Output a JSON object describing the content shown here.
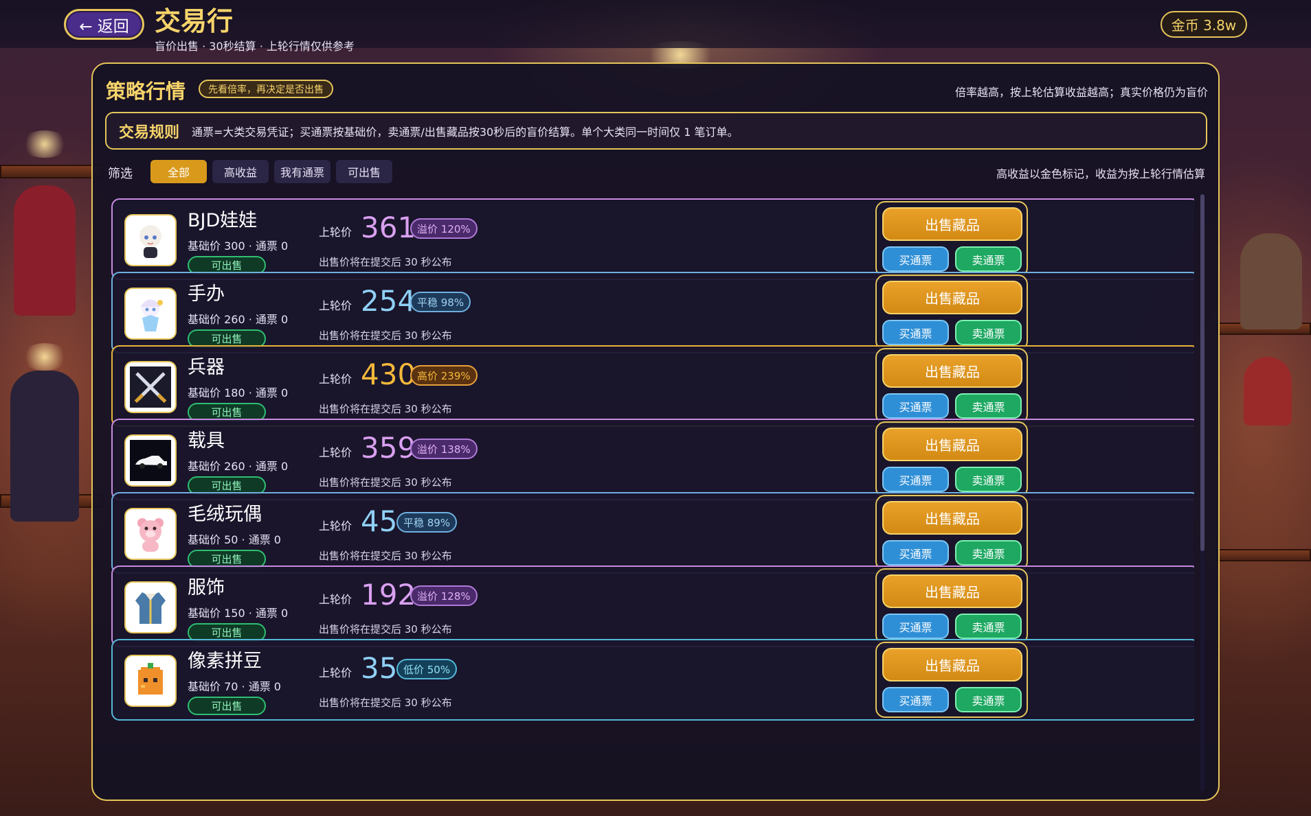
{
  "header": {
    "back_label": "← 返回",
    "title": "交易行",
    "subtitle": "盲价出售 · 30秒结算 · 上轮行情仅供参考",
    "coins": "金币 3.8w"
  },
  "panel": {
    "title": "策略行情",
    "tip": "先看倍率，再决定是否出售",
    "note": "倍率越高，按上轮估算收益越高；真实价格仍为盲价",
    "rules_title": "交易规则",
    "rules_text": "通票=大类交易凭证；买通票按基础价，卖通票/出售藏品按30秒后的盲价结算。单个大类同一时间仅 1 笔订单。",
    "filter_label": "筛选",
    "filters": [
      "全部",
      "高收益",
      "我有通票",
      "可出售"
    ],
    "active_filter": "全部",
    "filter_note": "高收益以金色标记，收益为按上轮行情估算"
  },
  "labels": {
    "last_price": "上轮价",
    "sell_item": "出售藏品",
    "buy_ticket": "买通票",
    "sell_ticket": "卖通票",
    "reveal": "出售价将在提交后 30 秒公布"
  },
  "items": [
    {
      "name": "BJD娃娃",
      "meta": "基础价 300 · 通票 0",
      "status": "可出售",
      "price": "361",
      "badge": "溢价 120%",
      "tier": "premium",
      "icon": "bjd-doll-icon"
    },
    {
      "name": "手办",
      "meta": "基础价 260 · 通票 0",
      "status": "可出售",
      "price": "254",
      "badge": "平稳 98%",
      "tier": "flat",
      "icon": "figure-icon"
    },
    {
      "name": "兵器",
      "meta": "基础价 180 · 通票 0",
      "status": "可出售",
      "price": "430",
      "badge": "高价 239%",
      "tier": "high",
      "icon": "crossed-swords-icon"
    },
    {
      "name": "载具",
      "meta": "基础价 260 · 通票 0",
      "status": "可出售",
      "price": "359",
      "badge": "溢价 138%",
      "tier": "premium",
      "icon": "car-icon"
    },
    {
      "name": "毛绒玩偶",
      "meta": "基础价 50 · 通票 0",
      "status": "可出售",
      "price": "45",
      "badge": "平稳 89%",
      "tier": "flat",
      "icon": "plush-bear-icon"
    },
    {
      "name": "服饰",
      "meta": "基础价 150 · 通票 0",
      "status": "可出售",
      "price": "192",
      "badge": "溢价 128%",
      "tier": "premium",
      "icon": "jacket-icon"
    },
    {
      "name": "像素拼豆",
      "meta": "基础价 70 · 通票 0",
      "status": "可出售",
      "price": "35",
      "badge": "低价 50%",
      "tier": "low",
      "icon": "pixel-bead-icon"
    }
  ]
}
